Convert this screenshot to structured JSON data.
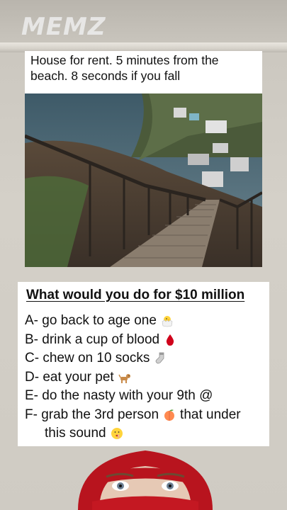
{
  "watermark": "MEMZ",
  "meme": {
    "caption": "House for rent. 5 minutes from the beach. 8 seconds if you fall"
  },
  "quiz": {
    "title": "What would you do for $10 million",
    "options": [
      {
        "label": "A- go back to age one",
        "icon": "hatching-chick-icon"
      },
      {
        "label": "B- drink a cup of blood",
        "icon": "blood-drop-icon"
      },
      {
        "label": "C- chew on 10 socks",
        "icon": "socks-icon"
      },
      {
        "label": "D- eat your pet",
        "icon": "dog-icon"
      },
      {
        "label": "E- do the nasty with your 9th @",
        "icon": ""
      },
      {
        "label": "F- grab the 3rd person",
        "icon": "peach-icon",
        "label2": "that under",
        "label3": "this sound",
        "icon2": "shushing-face-icon"
      }
    ]
  }
}
